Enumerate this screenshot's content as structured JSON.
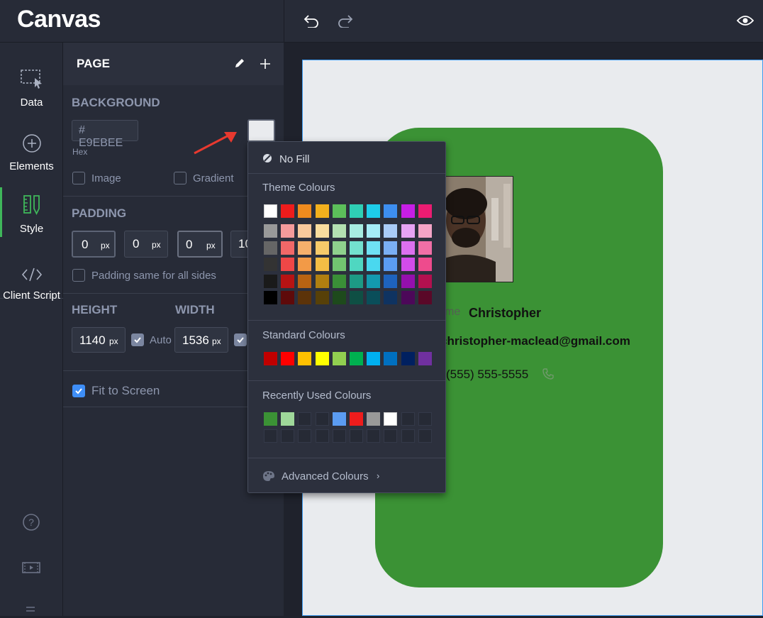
{
  "app": {
    "logo": "Canvas"
  },
  "rail": {
    "items": [
      {
        "label": "Data",
        "icon": "data-icon"
      },
      {
        "label": "Elements",
        "icon": "plus-circle-icon"
      },
      {
        "label": "Style",
        "icon": "style-icon",
        "active": true
      },
      {
        "label": "Client Script",
        "icon": "code-icon"
      }
    ]
  },
  "panel": {
    "title": "PAGE",
    "background": {
      "title": "BACKGROUND",
      "hex_value": "# E9EBEE",
      "hex_label": "Hex",
      "image_label": "Image",
      "gradient_label": "Gradient",
      "swatch_color": "#e9ebee"
    },
    "padding": {
      "title": "PADDING",
      "values": [
        "0",
        "0",
        "0",
        "10"
      ],
      "unit": "px",
      "same_label": "Padding same for all sides"
    },
    "height": {
      "title": "HEIGHT",
      "value": "1140",
      "unit": "px",
      "auto_label": "Auto"
    },
    "width": {
      "title": "WIDTH",
      "value": "1536",
      "unit": "px"
    },
    "fit_label": "Fit to Screen"
  },
  "card": {
    "name_label": "me",
    "name_value": "Christopher",
    "email": "christopher-maclead@gmail.com",
    "phone": "(555) 555-5555"
  },
  "popup": {
    "no_fill": "No Fill",
    "theme_title": "Theme Colours",
    "theme_row": [
      "#ffffff",
      "#ee1c1c",
      "#ef8b1e",
      "#f2b01d",
      "#5cbf5a",
      "#2fcfb5",
      "#1ecdea",
      "#3d8ef0",
      "#c61ee6",
      "#eb1c72"
    ],
    "theme_shades": [
      [
        "#999999",
        "#f49b9b",
        "#f8c99c",
        "#f9dd9e",
        "#b3e0b1",
        "#a7ece1",
        "#a5ecf7",
        "#a9cbf7",
        "#e6a3f4",
        "#f4a4c6"
      ],
      [
        "#666666",
        "#f16868",
        "#f5b06c",
        "#f6ca6a",
        "#8fd18d",
        "#73e1cf",
        "#6fe1f3",
        "#7aaff4",
        "#dc70ef",
        "#f06fa6"
      ],
      [
        "#333333",
        "#ef4747",
        "#f29a47",
        "#f3bd45",
        "#72c570",
        "#4fd7c1",
        "#4ad8ef",
        "#5b9cf2",
        "#d24cea",
        "#ee4b8d"
      ],
      [
        "#1a1a1a",
        "#b71313",
        "#b86312",
        "#b07f10",
        "#3a8f37",
        "#1d9a85",
        "#139aaf",
        "#1e63bd",
        "#9410ad",
        "#b3104f"
      ],
      [
        "#000000",
        "#5e0a0a",
        "#5c3309",
        "#574008",
        "#1e4a1c",
        "#0f4f44",
        "#0a4e5a",
        "#0f3361",
        "#4c0859",
        "#5a0828"
      ]
    ],
    "standard_title": "Standard Colours",
    "standard": [
      "#c00000",
      "#ff0000",
      "#ffc000",
      "#ffff00",
      "#92d050",
      "#00b050",
      "#00b0f0",
      "#0070c0",
      "#002060",
      "#7030a0"
    ],
    "recent_title": "Recently Used Colours",
    "recent": [
      "#3b9235",
      "#9fd89a",
      "",
      "",
      "#5b9cf2",
      "#ee1c1c",
      "#999999",
      "#ffffff",
      "",
      ""
    ],
    "advanced": "Advanced Colours"
  },
  "colors": {
    "accent_green": "#3fb65a",
    "card_green": "#3b9235",
    "page_bg": "#e9ebee",
    "arrow": "#e8392f"
  }
}
